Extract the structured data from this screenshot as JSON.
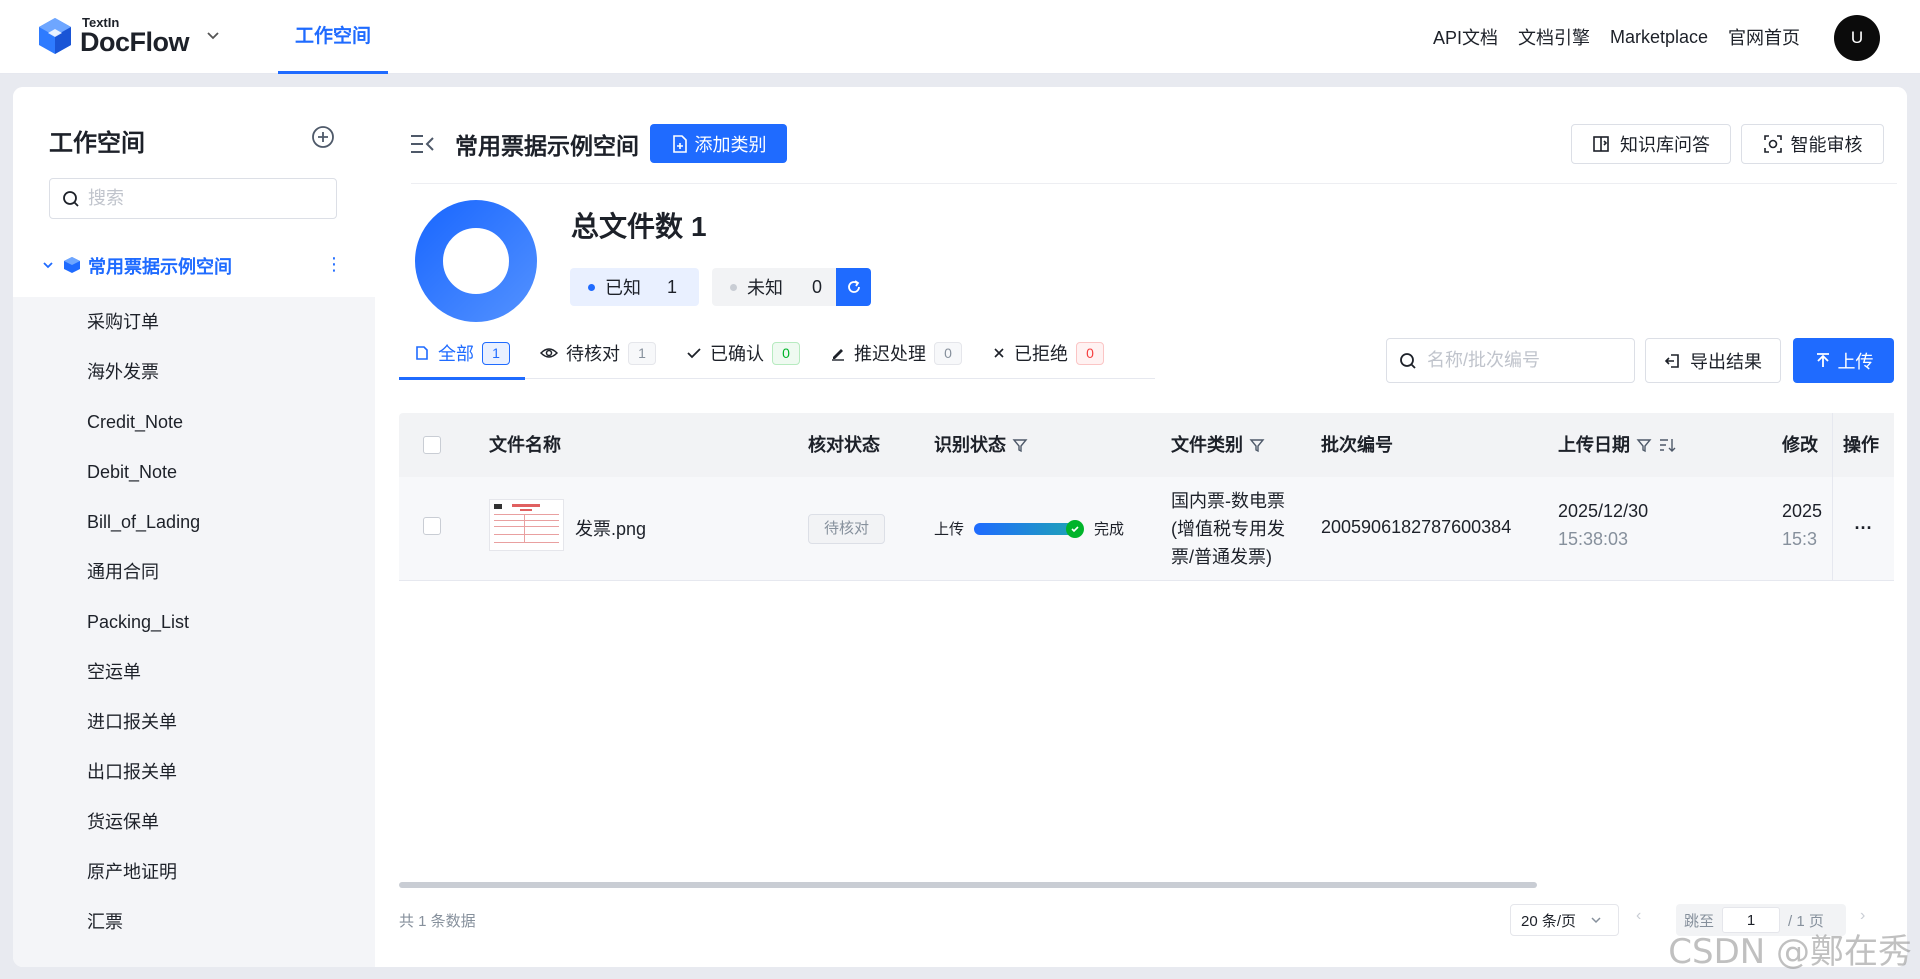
{
  "topbar": {
    "logo_small": "TextIn",
    "logo_big": "DocFlow",
    "active_tab": "工作空间",
    "links": [
      "API文档",
      "文档引擎",
      "Marketplace",
      "官网首页"
    ],
    "avatar_initial": "U",
    "accent_color": "#1f6bff"
  },
  "sidebar": {
    "title": "工作空间",
    "search_placeholder": "搜索",
    "space_name": "常用票据示例空间",
    "items": [
      "采购订单",
      "海外发票",
      "Credit_Note",
      "Debit_Note",
      "Bill_of_Lading",
      "通用合同",
      "Packing_List",
      "空运单",
      "进口报关单",
      "出口报关单",
      "货运保单",
      "原产地证明",
      "汇票"
    ]
  },
  "main": {
    "space_title": "常用票据示例空间",
    "add_category_label": "添加类别",
    "kb_button_label": "知识库问答",
    "audit_button_label": "智能审核",
    "total_label": "总文件数",
    "total_count": "1",
    "known_label": "已知",
    "known_count": "1",
    "unknown_label": "未知",
    "unknown_count": "0",
    "tabs": [
      {
        "label": "全部",
        "count": "1"
      },
      {
        "label": "待核对",
        "count": "1"
      },
      {
        "label": "已确认",
        "count": "0"
      },
      {
        "label": "推迟处理",
        "count": "0"
      },
      {
        "label": "已拒绝",
        "count": "0"
      }
    ],
    "search_placeholder": "名称/批次编号",
    "export_label": "导出结果",
    "upload_label": "上传"
  },
  "table": {
    "headers": [
      "文件名称",
      "核对状态",
      "识别状态",
      "文件类别",
      "批次编号",
      "上传日期",
      "修改",
      "操作"
    ],
    "rows": [
      {
        "file_name": "发票.png",
        "check_status": "待核对",
        "recog_start": "上传",
        "recog_end": "完成",
        "recog_progress": 1.0,
        "category": "国内票-数电票(增值税专用发票/普通发票)",
        "batch_no": "2005906182787600384",
        "upload_date": "2025/12/30",
        "upload_time": "15:38:03",
        "modified_date": "2025",
        "modified_time": "15:3",
        "action": "···"
      }
    ]
  },
  "footer": {
    "total_text": "共 1 条数据",
    "page_size": "20 条/页",
    "jump_label": "跳至",
    "current_page": "1",
    "page_total": "/ 1 页"
  },
  "watermark": "CSDN @鄭在秀"
}
